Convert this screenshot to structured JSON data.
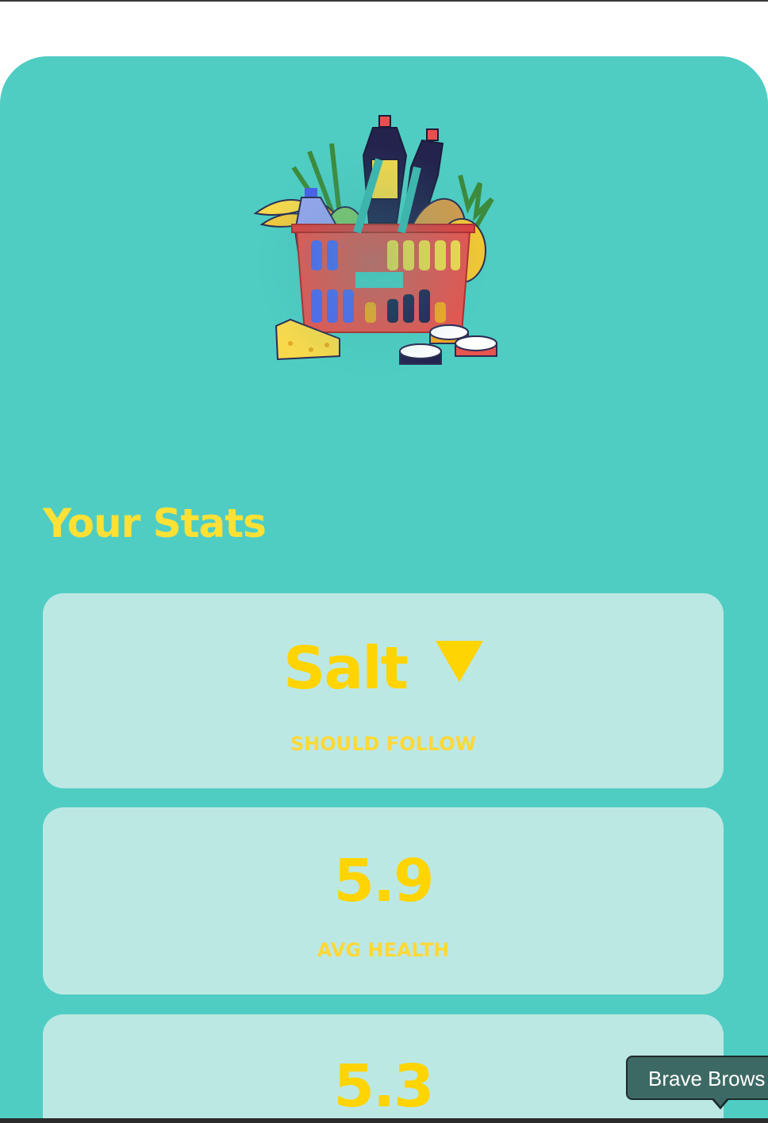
{
  "stats": {
    "title": "Your Stats",
    "cards": [
      {
        "value": "Salt",
        "label": "SHOULD FOLLOW",
        "indicator": "triangle-down-icon"
      },
      {
        "value": "5.9",
        "label": "AVG HEALTH"
      },
      {
        "value": "5.3",
        "label": ""
      }
    ]
  },
  "tooltip": {
    "text": "Brave Brows"
  },
  "colors": {
    "background": "#4fcdc3",
    "card": "#bce8e4",
    "accent": "#ffd400"
  }
}
